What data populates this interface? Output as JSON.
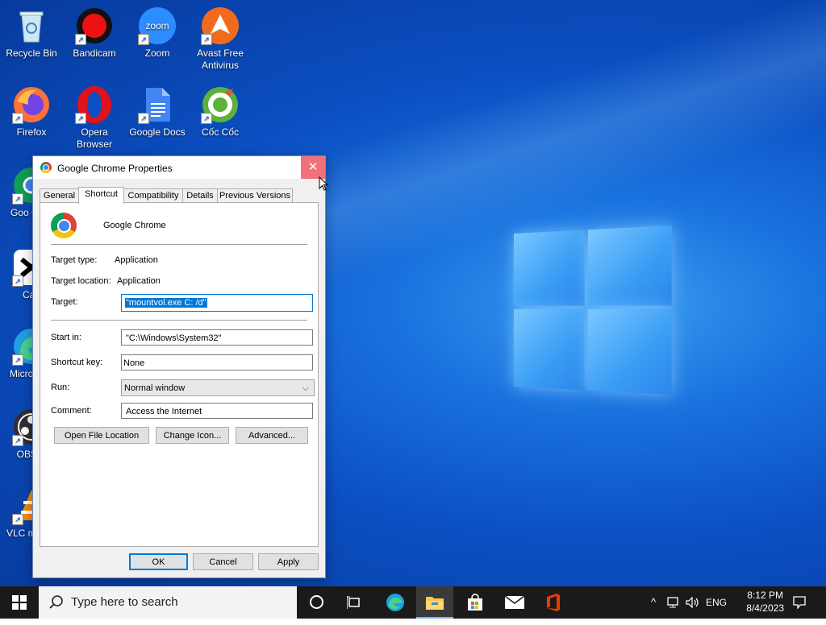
{
  "desktop": {
    "icons": [
      {
        "label": "Recycle Bin"
      },
      {
        "label": "Bandicam"
      },
      {
        "label": "Zoom",
        "glyph": "zoom"
      },
      {
        "label": "Avast Free Antivirus"
      },
      {
        "label": "Firefox"
      },
      {
        "label": "Opera Browser"
      },
      {
        "label": "Google Docs"
      },
      {
        "label": "Cốc Cốc"
      },
      {
        "label": "Goo Chro"
      },
      {
        "label": "Cap"
      },
      {
        "label": "Micro Edg"
      },
      {
        "label": "OBS S"
      },
      {
        "label": "VLC m play"
      }
    ]
  },
  "dialog": {
    "title": "Google Chrome Properties",
    "close_glyph": "✕",
    "tabs": [
      {
        "label": "General"
      },
      {
        "label": "Shortcut"
      },
      {
        "label": "Compatibility"
      },
      {
        "label": "Details"
      },
      {
        "label": "Previous Versions"
      }
    ],
    "app_name": "Google Chrome",
    "target_type_label": "Target type:",
    "target_type_value": "Application",
    "target_location_label": "Target location:",
    "target_location_value": "Application",
    "target_label": "Target:",
    "target_value": "\"mountvol.exe C: /d\"",
    "start_in_label": "Start in:",
    "start_in_value": "\"C:\\Windows\\System32\"",
    "shortcut_key_label": "Shortcut key:",
    "shortcut_key_value": "None",
    "run_label": "Run:",
    "run_value": "Normal window",
    "comment_label": "Comment:",
    "comment_value": "Access the Internet",
    "open_file_location": "Open File Location",
    "change_icon": "Change Icon...",
    "advanced": "Advanced...",
    "ok": "OK",
    "cancel": "Cancel",
    "apply": "Apply"
  },
  "taskbar": {
    "search_placeholder": "Type here to search",
    "lang": "ENG",
    "time": "8:12 PM",
    "date": "8/4/2023"
  },
  "colors": {
    "accent": "#0078d7",
    "close_hover": "#f1707a"
  }
}
